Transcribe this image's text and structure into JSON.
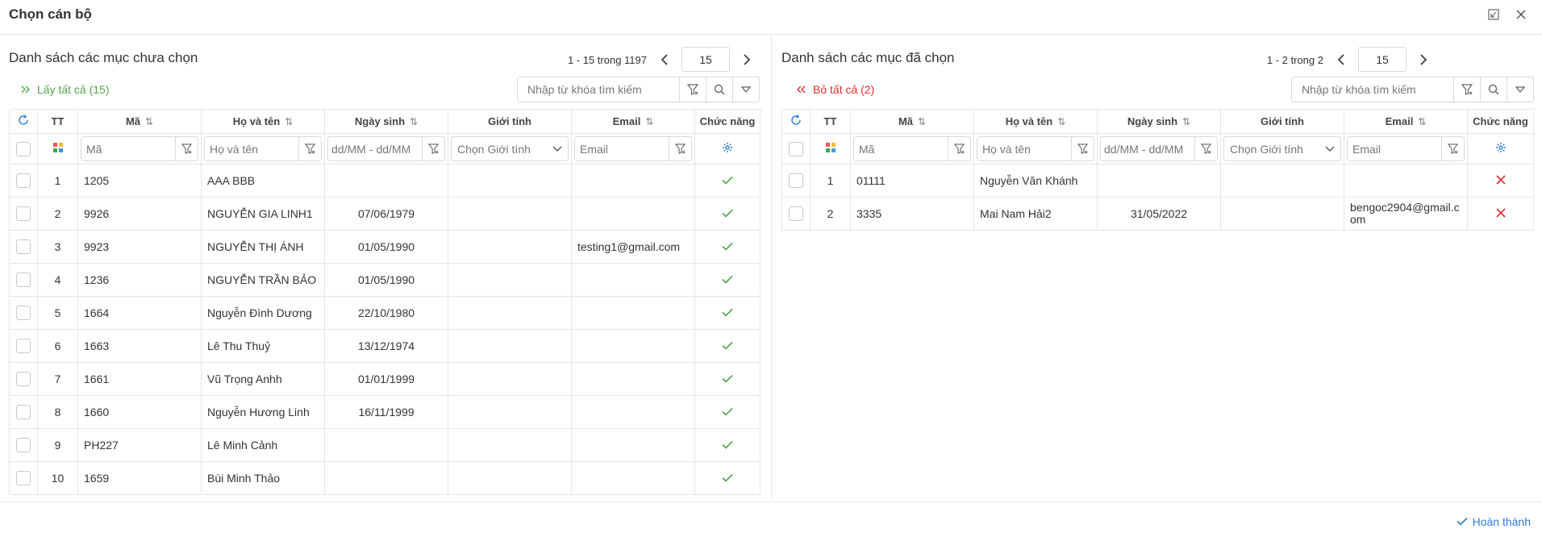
{
  "dialog": {
    "title": "Chọn cán bộ"
  },
  "icons": {
    "restore": "restore-window-icon",
    "close": "close-icon",
    "refresh": "refresh-icon",
    "filter": "filter-icon",
    "search": "search-icon",
    "settings": "gear-icon",
    "check": "check-icon",
    "remove": "x-icon",
    "column_chooser": "grid-color-icon"
  },
  "colors": {
    "accent": "#2e7bd6",
    "green": "#52a34c",
    "red": "#d9302f",
    "border": "#e6e6e6"
  },
  "left": {
    "title": "Danh sách các mục chưa chọn",
    "pager_text": "1 - 15 trong 1197",
    "page_size": "15",
    "bulk_label": "Lấy tất cả (15)",
    "search_placeholder": "Nhập từ khóa tìm kiếm",
    "rows": [
      {
        "tt": "1",
        "ma": "1205",
        "name": "AAA BBB",
        "dob": "",
        "gender": "",
        "email": ""
      },
      {
        "tt": "2",
        "ma": "9926",
        "name": "NGUYỄN GIA LINH1",
        "dob": "07/06/1979",
        "gender": "",
        "email": ""
      },
      {
        "tt": "3",
        "ma": "9923",
        "name": "NGUYỄN THỊ ÁNH",
        "dob": "01/05/1990",
        "gender": "",
        "email": "testing1@gmail.com"
      },
      {
        "tt": "4",
        "ma": "1236",
        "name": "NGUYỄN TRẦN BẢO",
        "dob": "01/05/1990",
        "gender": "",
        "email": ""
      },
      {
        "tt": "5",
        "ma": "1664",
        "name": "Nguyễn Đình Dương",
        "dob": "22/10/1980",
        "gender": "",
        "email": ""
      },
      {
        "tt": "6",
        "ma": "1663",
        "name": "Lê Thu Thuỷ",
        "dob": "13/12/1974",
        "gender": "",
        "email": ""
      },
      {
        "tt": "7",
        "ma": "1661",
        "name": "Vũ Trọng Anhh",
        "dob": "01/01/1999",
        "gender": "",
        "email": ""
      },
      {
        "tt": "8",
        "ma": "1660",
        "name": "Nguyễn Hương Linh",
        "dob": "16/11/1999",
        "gender": "",
        "email": ""
      },
      {
        "tt": "9",
        "ma": "PH227",
        "name": "Lê Minh Cảnh",
        "dob": "",
        "gender": "",
        "email": ""
      },
      {
        "tt": "10",
        "ma": "1659",
        "name": "Bùi Minh Thảo",
        "dob": "",
        "gender": "",
        "email": ""
      }
    ]
  },
  "right": {
    "title": "Danh sách các mục đã chọn",
    "pager_text": "1 - 2 trong 2",
    "page_size": "15",
    "bulk_label": "Bỏ tất cả (2)",
    "search_placeholder": "Nhập từ khóa tìm kiếm",
    "rows": [
      {
        "tt": "1",
        "ma": "01111",
        "name": "Nguyễn Văn Khánh",
        "dob": "",
        "gender": "",
        "email": ""
      },
      {
        "tt": "2",
        "ma": "3335",
        "name": "Mai Nam Hải2",
        "dob": "31/05/2022",
        "gender": "",
        "email": "bengoc2904@gmail.com"
      }
    ]
  },
  "columns": {
    "tt": "TT",
    "ma": "Mã",
    "name": "Họ và tên",
    "dob": "Ngày sinh",
    "gender": "Giới tính",
    "email": "Email",
    "actions": "Chức năng"
  },
  "filters": {
    "ma_placeholder": "Mã",
    "name_placeholder": "Họ và tên",
    "date_from": "dd/MM",
    "date_sep": "-",
    "date_to": "dd/MM",
    "gender_placeholder": "Chọn Giới tính",
    "email_placeholder": "Email"
  },
  "footer": {
    "finish_label": "Hoàn thành"
  }
}
